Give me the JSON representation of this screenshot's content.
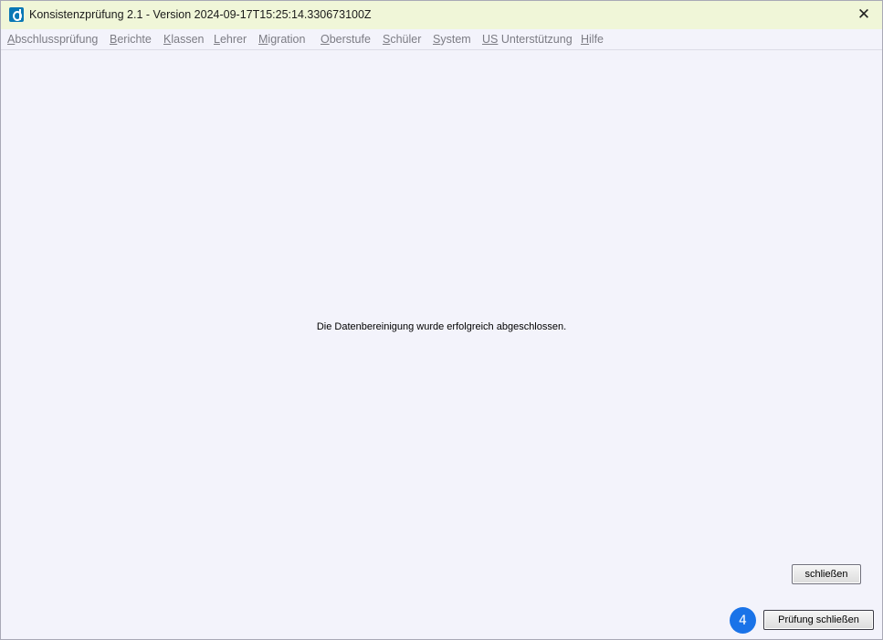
{
  "window": {
    "title": "Konsistenzprüfung 2.1 - Version 2024-09-17T15:25:14.330673100Z",
    "close_glyph": "✕"
  },
  "menu": {
    "items": [
      {
        "mnemonic": "A",
        "rest": "bschlussprüfung"
      },
      {
        "mnemonic": "B",
        "rest": "erichte"
      },
      {
        "mnemonic": "K",
        "rest": "lassen"
      },
      {
        "mnemonic": "L",
        "rest": "ehrer"
      },
      {
        "mnemonic": "M",
        "rest": "igration"
      },
      {
        "mnemonic": "O",
        "rest": "berstufe"
      },
      {
        "mnemonic": "S",
        "rest": "chüler"
      },
      {
        "mnemonic": "S",
        "rest": "ystem"
      },
      {
        "mnemonic": "US",
        "rest": " Unterstützung"
      },
      {
        "mnemonic": "H",
        "rest": "ilfe"
      }
    ]
  },
  "main": {
    "message": "Die Datenbereinigung wurde erfolgreich abgeschlossen."
  },
  "buttons": {
    "close_label": "schließen",
    "close_check_label": "Prüfung schließen"
  },
  "annotation": {
    "step_number": "4"
  },
  "colors": {
    "titlebar_bg": "#f0f6d8",
    "window_bg": "#f3f3fb",
    "badge": "#1a73e8"
  }
}
